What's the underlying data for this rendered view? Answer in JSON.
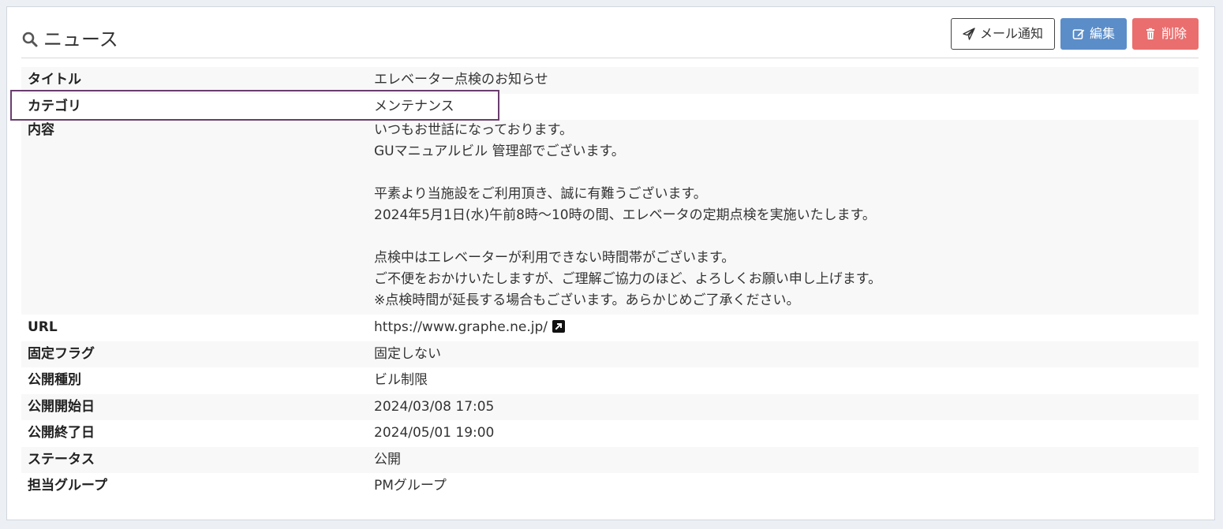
{
  "header": {
    "title": "ニュース",
    "title_icon": "search-icon",
    "buttons": {
      "mail_notify": "メール通知",
      "edit": "編集",
      "delete": "削除"
    }
  },
  "colors": {
    "primary": "#5b8dc9",
    "danger": "#ea6e6e",
    "highlight_border": "#6a3d6e"
  },
  "details": {
    "title": {
      "label": "タイトル",
      "value": "エレベーター点検のお知らせ"
    },
    "category": {
      "label": "カテゴリ",
      "value": "メンテナンス"
    },
    "content": {
      "label": "内容",
      "lines": [
        "いつもお世話になっております。",
        "GUマニュアルビル 管理部でございます。",
        "",
        "平素より当施設をご利用頂き、誠に有難うございます。",
        "2024年5月1日(水)午前8時～10時の間、エレベータの定期点検を実施いたします。",
        "",
        "点検中はエレベーターが利用できない時間帯がございます。",
        "ご不便をおかけいたしますが、ご理解ご協力のほど、よろしくお願い申し上げます。",
        "※点検時間が延長する場合もございます。あらかじめご了承ください。"
      ]
    },
    "url": {
      "label": "URL",
      "value": "https://www.graphe.ne.jp/"
    },
    "fixed_flag": {
      "label": "固定フラグ",
      "value": "固定しない"
    },
    "publish_type": {
      "label": "公開種別",
      "value": "ビル制限"
    },
    "publish_start": {
      "label": "公開開始日",
      "value": "2024/03/08 17:05"
    },
    "publish_end": {
      "label": "公開終了日",
      "value": "2024/05/01 19:00"
    },
    "status": {
      "label": "ステータス",
      "value": "公開"
    },
    "group": {
      "label": "担当グループ",
      "value": "PMグループ"
    }
  }
}
